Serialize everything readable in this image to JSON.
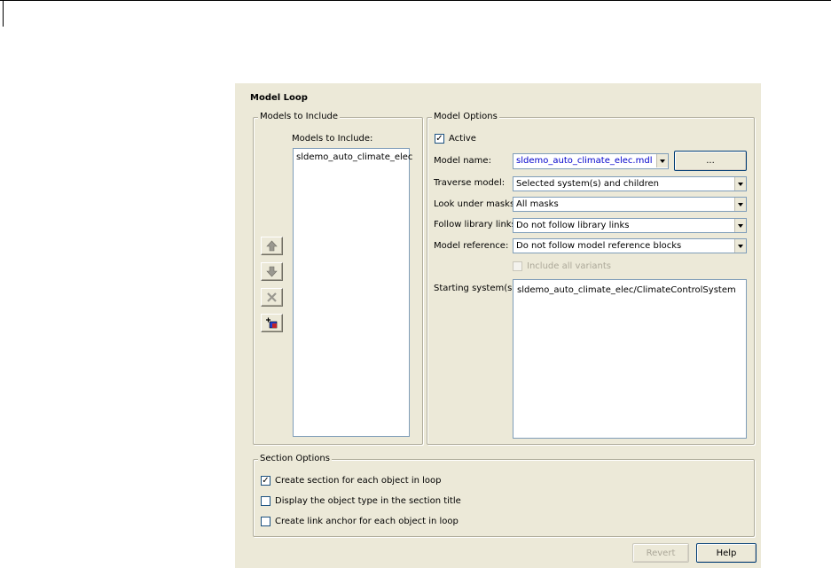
{
  "panel": {
    "title": "Model Loop"
  },
  "models_group": {
    "legend": "Models to Include",
    "list_label": "Models to Include:",
    "items": [
      "sldemo_auto_climate_elec"
    ]
  },
  "model_options": {
    "legend": "Model Options",
    "active_label": "Active",
    "active_checked": true,
    "model_name_label": "Model name:",
    "model_name_value": "sldemo_auto_climate_elec.mdl",
    "browse_label": "...",
    "traverse_label": "Traverse model:",
    "traverse_value": "Selected system(s) and children",
    "masks_label": "Look under masks:",
    "masks_value": "All masks",
    "library_label": "Follow library links:",
    "library_value": "Do not follow library links",
    "reference_label": "Model reference:",
    "reference_value": "Do not follow model reference blocks",
    "variants_label": "Include all variants",
    "starting_label": "Starting system(s):",
    "starting_value": "sldemo_auto_climate_elec/ClimateControlSystem"
  },
  "section_options": {
    "legend": "Section Options",
    "items": [
      {
        "label": "Create section for each object in loop",
        "checked": true
      },
      {
        "label": "Display the object type in the section title",
        "checked": false
      },
      {
        "label": "Create link anchor for each object in loop",
        "checked": false
      }
    ]
  },
  "footer": {
    "revert_label": "Revert",
    "help_label": "Help"
  },
  "colors": {
    "panel_bg": "#ece9d8",
    "link_text": "#0000cc",
    "field_border": "#7f9db9"
  },
  "icons": [
    "move-up-icon",
    "move-down-icon",
    "delete-icon",
    "add-model-icon"
  ]
}
